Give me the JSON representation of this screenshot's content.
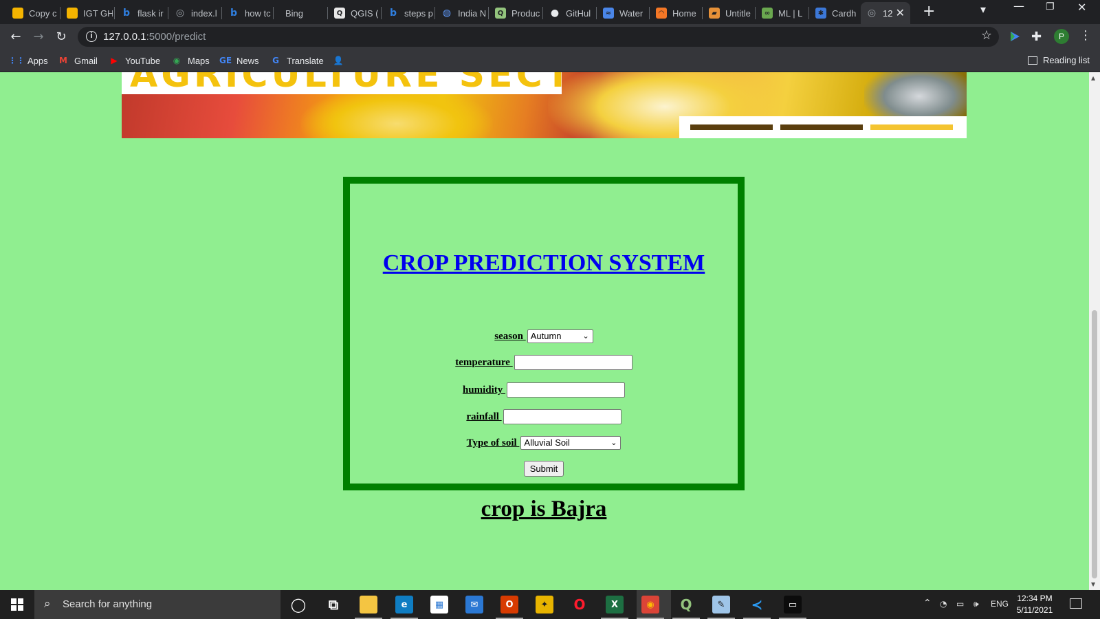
{
  "browser": {
    "tabs": [
      {
        "title": "Copy c",
        "icon": "slides-icon",
        "color": "#f4b400",
        "glyph": ""
      },
      {
        "title": "IGT GH",
        "icon": "slides-icon",
        "color": "#f4b400",
        "glyph": ""
      },
      {
        "title": "flask ir",
        "icon": "bing-icon",
        "color": "#2f7fe0",
        "glyph": "b"
      },
      {
        "title": "index.l",
        "icon": "globe-icon",
        "color": "#9aa0a6",
        "glyph": "◎"
      },
      {
        "title": "how tc",
        "icon": "bing-icon",
        "color": "#2f7fe0",
        "glyph": "b"
      },
      {
        "title": "Bing",
        "icon": "",
        "color": "",
        "glyph": ""
      },
      {
        "title": "QGIS (",
        "icon": "qgis-doc-icon",
        "color": "#e8e8e8",
        "glyph": "Q"
      },
      {
        "title": "steps p",
        "icon": "bing-icon",
        "color": "#2f7fe0",
        "glyph": "b"
      },
      {
        "title": "India N",
        "icon": "globe-icon",
        "color": "#5e97f6",
        "glyph": "◍"
      },
      {
        "title": "Produc",
        "icon": "qgis-icon",
        "color": "#93c47d",
        "glyph": "Q"
      },
      {
        "title": "GitHul",
        "icon": "github-icon",
        "color": "#e8eaed",
        "glyph": "●"
      },
      {
        "title": "Water",
        "icon": "water-icon",
        "color": "#4a86e8",
        "glyph": "≈"
      },
      {
        "title": "Home",
        "icon": "jupyter-icon",
        "color": "#f37726",
        "glyph": "◠"
      },
      {
        "title": "Untitle",
        "icon": "notebook-icon",
        "color": "#e69138",
        "glyph": "▰"
      },
      {
        "title": "ML | L",
        "icon": "ml-icon",
        "color": "#6aa84f",
        "glyph": "∞"
      },
      {
        "title": "Cardh",
        "icon": "asterisk-icon",
        "color": "#3c78d8",
        "glyph": "✱"
      },
      {
        "title": "12",
        "icon": "globe-icon",
        "color": "#9aa0a6",
        "glyph": "◎",
        "active": true
      }
    ],
    "url_host": "127.0.0.1",
    "url_path": ":5000/predict",
    "profile_initial": "P",
    "bookmarks": [
      {
        "label": "Apps",
        "icon": "apps-grid-icon",
        "color": "#4285f4",
        "glyph": "⋮⋮"
      },
      {
        "label": "Gmail",
        "icon": "gmail-icon",
        "color": "#ea4335",
        "glyph": "M"
      },
      {
        "label": "YouTube",
        "icon": "youtube-icon",
        "color": "#ff0000",
        "glyph": "▶"
      },
      {
        "label": "Maps",
        "icon": "maps-icon",
        "color": "#34a853",
        "glyph": "◉"
      },
      {
        "label": "News",
        "icon": "news-icon",
        "color": "#4285f4",
        "glyph": "GE"
      },
      {
        "label": "Translate",
        "icon": "translate-icon",
        "color": "#4285f4",
        "glyph": "G"
      },
      {
        "label": "",
        "icon": "contacts-icon",
        "color": "#0f9d58",
        "glyph": "👤"
      }
    ],
    "reading_list": "Reading list"
  },
  "page": {
    "banner_title": "AGRICULTURE SECTOR",
    "banner_bar_colors": [
      "#5a3e0e",
      "#5a3e0e",
      "#f4c430"
    ],
    "background": "#90ee90",
    "form": {
      "title": "CROP PREDICTION SYSTEM",
      "season_label": "season ",
      "season_value": "Autumn",
      "temperature_label": "temperature ",
      "humidity_label": "humidity ",
      "rainfall_label": "rainfall ",
      "soil_label": "Type of soil ",
      "soil_value": "Alluvial Soil",
      "submit_label": "Submit"
    },
    "result": "crop is Bajra"
  },
  "taskbar": {
    "search_placeholder": "Search for anything",
    "apps": [
      "cortana-icon",
      "task-view-icon",
      "file-explorer-icon",
      "edge-icon",
      "store-icon",
      "mail-icon",
      "office-icon",
      "puzzle-app-icon",
      "opera-icon",
      "excel-icon",
      "chrome-icon",
      "qgis-icon",
      "notepad-icon",
      "vscode-icon",
      "terminal-icon"
    ],
    "language": "ENG",
    "time": "12:34 PM",
    "date": "5/11/2021"
  }
}
